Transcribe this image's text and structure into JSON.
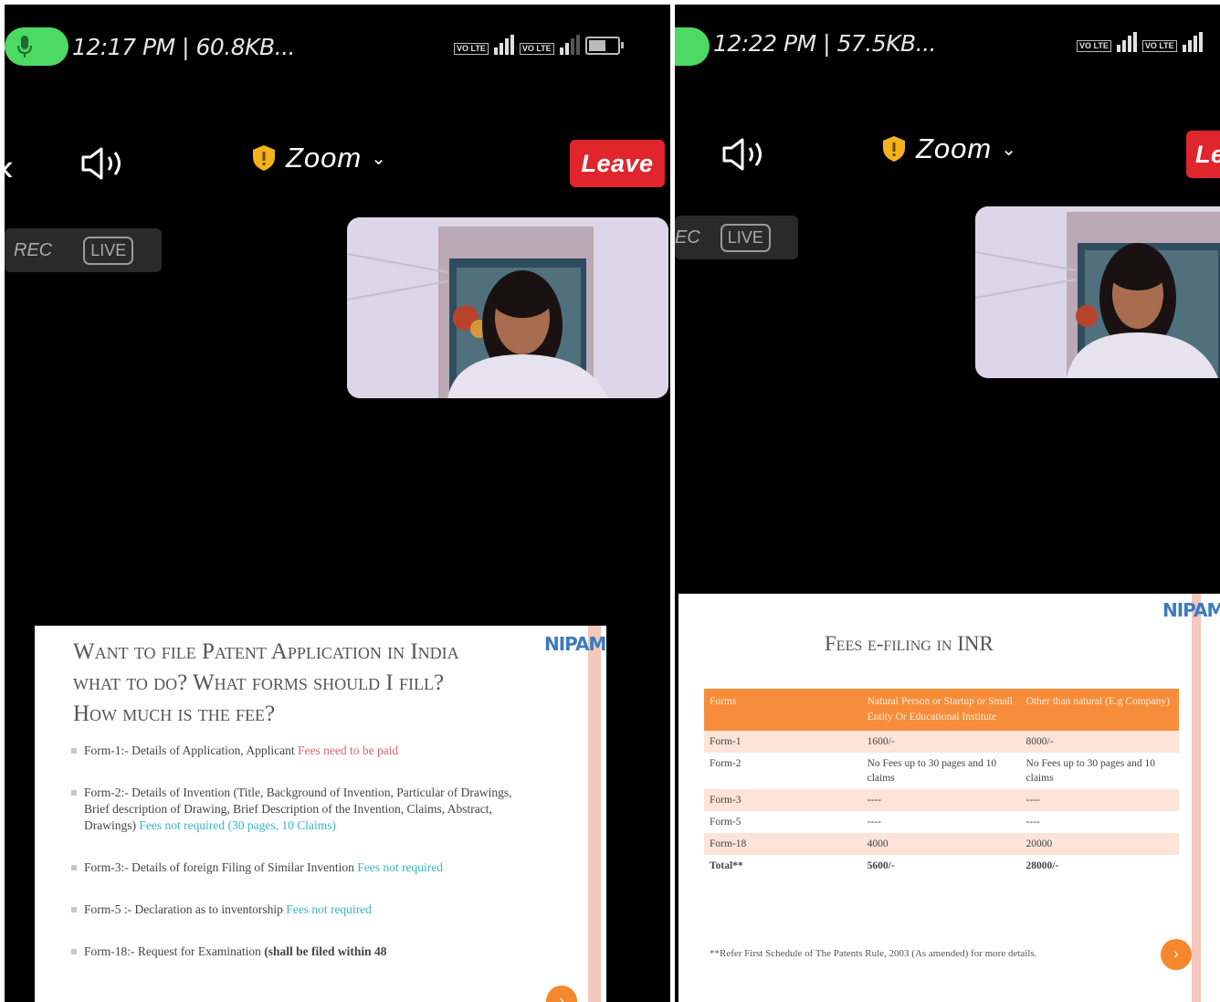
{
  "left": {
    "status": {
      "time_text": "12:17 PM | 60.8KB...",
      "net1": "VO LTE",
      "net2": "VO LTE"
    },
    "toolbar": {
      "back": "‹",
      "app_title": "Zoom",
      "chevron": "⌄",
      "leave_label": "Leave"
    },
    "badges": {
      "rec": "REC",
      "live": "LIVE"
    },
    "slide": {
      "logo": "NIPAM",
      "title_lines": [
        "Want to file Patent Application in India",
        "what to do?   What forms should I fill?",
        "How much is the fee?"
      ],
      "bullets": [
        {
          "text": "Form-1:- Details of Application, Applicant ",
          "note": "Fees need to be paid"
        },
        {
          "text": "Form-2:- Details of Invention (Title, Background of Invention, Particular of Drawings, Brief description of Drawing, Brief Description of the Invention, Claims, Abstract, Drawings) ",
          "note": "Fees not required (30 pages, 10 Claims)"
        },
        {
          "text": "Form-3:- Details of foreign Filing of Similar Invention ",
          "note": "Fees not required"
        },
        {
          "text": "Form-5 :- Declaration as to inventorship ",
          "note": "Fees not required"
        },
        {
          "text": "Form-18:- Request for Examination ",
          "bold": "(shall be filed within 48"
        }
      ]
    }
  },
  "right": {
    "status": {
      "time_text": "12:22 PM | 57.5KB...",
      "net1": "VO LTE",
      "net2": "VO LTE"
    },
    "toolbar": {
      "app_title": "Zoom",
      "chevron": "⌄",
      "leave_label": "Le"
    },
    "badges": {
      "rec": "EC",
      "live": "LIVE"
    },
    "slide": {
      "logo": "NIPAM",
      "title": "Fees e-filing in INR",
      "table": {
        "headers": [
          "Forms",
          "Natural Person or Startup or Small Entity Or Educational Institute",
          "Other than natural (E.g Company)"
        ],
        "rows": [
          [
            "Form-1",
            "1600/-",
            "8000/-"
          ],
          [
            "Form-2",
            "No Fees up to 30 pages and 10 claims",
            "No Fees up to 30 pages and 10 claims"
          ],
          [
            "Form-3",
            "----",
            "----"
          ],
          [
            "Form-5",
            "----",
            "----"
          ],
          [
            "Form-18",
            "4000",
            "20000"
          ],
          [
            "Total**",
            "5600/-",
            "28000/-"
          ]
        ]
      },
      "footnote": "**Refer First Schedule of The Patents Rule, 2003 (As amended) for more details."
    }
  },
  "colors": {
    "leave": "#e0252c",
    "mic": "#4cd964",
    "table_header": "#f78d3a",
    "accent_red": "#e0626d",
    "accent_teal": "#3ab5c6"
  },
  "icons": {
    "speaker": "speaker-icon",
    "shield": "shield-icon",
    "mic": "mic-icon"
  }
}
